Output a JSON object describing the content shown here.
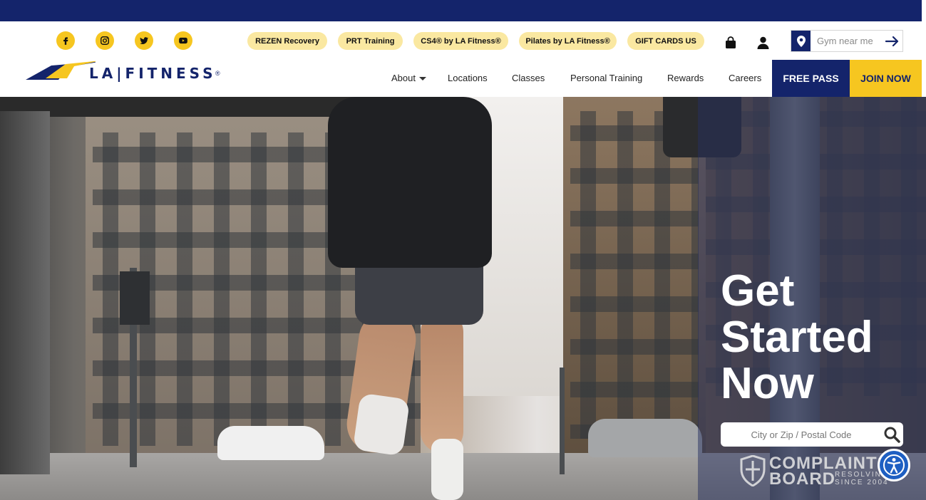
{
  "social": [
    {
      "name": "facebook",
      "icon": "facebook-icon"
    },
    {
      "name": "instagram",
      "icon": "instagram-icon"
    },
    {
      "name": "twitter",
      "icon": "twitter-icon"
    },
    {
      "name": "youtube",
      "icon": "youtube-icon"
    }
  ],
  "promo_pills": [
    "REZEN Recovery",
    "PRT Training",
    "CS4® by LA Fitness®",
    "Pilates by LA Fitness®",
    "GIFT CARDS US"
  ],
  "header_icons": {
    "cart": "shopping-bag-icon",
    "account": "user-icon"
  },
  "gym_search": {
    "placeholder": "Gym near me",
    "pin_icon": "map-pin-icon",
    "go_icon": "arrow-right-icon"
  },
  "logo": {
    "text": "LA|FITNESS",
    "mark": "®"
  },
  "nav": {
    "about": "About",
    "locations": "Locations",
    "classes": "Classes",
    "personal_training": "Personal Training",
    "rewards": "Rewards",
    "careers": "Careers",
    "free_pass": "FREE PASS",
    "join_now": "JOIN NOW"
  },
  "hero": {
    "title_line1": "Get",
    "title_line2": "Started",
    "title_line3": "Now",
    "zip_placeholder": "City or Zip / Postal Code",
    "search_icon": "magnifier-icon"
  },
  "complaints_badge": {
    "line1": "COMPLAINTS",
    "line2": "BOARD",
    "line3": "RESOLVING",
    "line4": "SINCE 2004"
  },
  "accessibility": {
    "icon": "accessibility-icon"
  },
  "colors": {
    "navy": "#14246b",
    "gold": "#f6c620",
    "pill": "#fae8a1",
    "a11y_blue": "#1e5fc2"
  }
}
